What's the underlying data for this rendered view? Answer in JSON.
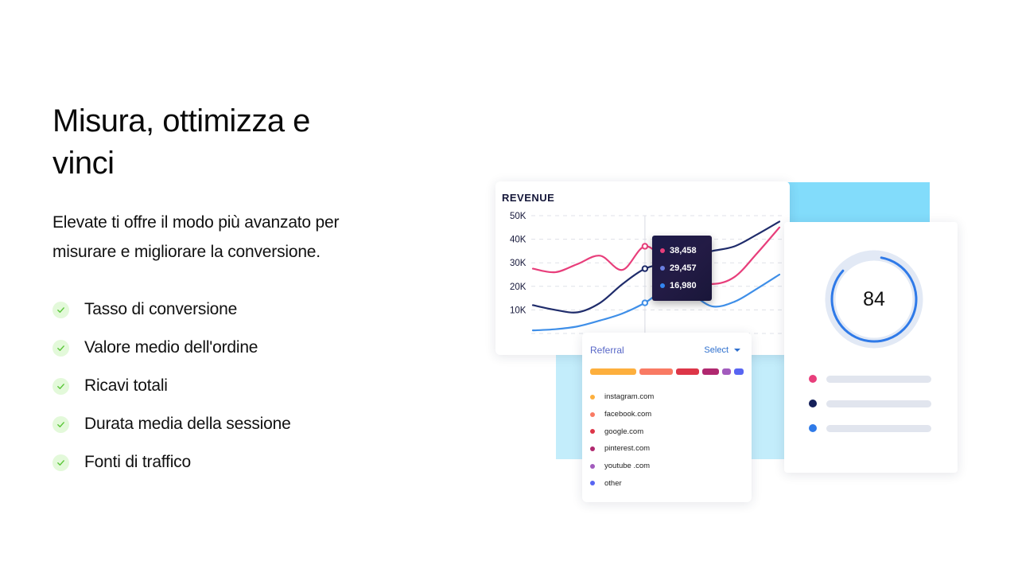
{
  "hero": {
    "headline": "Misura, ottimizza e vinci",
    "lead": "Elevate ti offre il modo più avanzato per misurare e migliorare la conversione.",
    "features": [
      {
        "label": "Tasso di conversione",
        "icon": "check-icon"
      },
      {
        "label": "Valore medio dell'ordine",
        "icon": "check-icon"
      },
      {
        "label": "Ricavi totali",
        "icon": "check-icon"
      },
      {
        "label": "Durata media della sessione",
        "icon": "check-icon"
      },
      {
        "label": "Fonti di traffico",
        "icon": "check-icon"
      }
    ]
  },
  "colors": {
    "check_bg": "#e3f9da",
    "check_fg": "#5cc73b",
    "accent_blue_bg": "#82dcfb",
    "series_pink": "#e83e7b",
    "series_navy": "#1f2c6b",
    "series_blue": "#3f8fe8"
  },
  "revenue": {
    "title": "REVENUE",
    "tooltip": [
      {
        "value": "38,458",
        "color": "#e83e7b"
      },
      {
        "value": "29,457",
        "color": "#6a7fe0"
      },
      {
        "value": "16,980",
        "color": "#3385f0"
      }
    ]
  },
  "chart_data": {
    "type": "line",
    "title": "REVENUE",
    "xlabel": "",
    "ylabel": "",
    "ylim": [
      0,
      50000
    ],
    "yticks": [
      "50K",
      "40K",
      "30K",
      "20K",
      "10K"
    ],
    "ytick_values": [
      50000,
      40000,
      30000,
      20000,
      10000
    ],
    "grid": true,
    "hover_index": 5,
    "x": [
      0,
      1,
      2,
      3,
      4,
      5,
      6,
      7,
      8,
      9,
      10,
      11
    ],
    "series": [
      {
        "name": "pink",
        "color": "#e83e7b",
        "values": [
          27500,
          26000,
          29500,
          33000,
          27000,
          37000,
          30000,
          24000,
          21000,
          24000,
          34000,
          45000
        ]
      },
      {
        "name": "navy",
        "color": "#1f2c6b",
        "values": [
          12000,
          10000,
          9000,
          13000,
          21000,
          27500,
          30000,
          33000,
          35000,
          37000,
          42000,
          47500
        ]
      },
      {
        "name": "blue",
        "color": "#3f8fe8",
        "values": [
          1300,
          1800,
          3000,
          5500,
          8500,
          13000,
          19000,
          17000,
          11500,
          13500,
          19000,
          25000
        ]
      }
    ]
  },
  "referral": {
    "title": "Referral",
    "select_label": "Select",
    "bar": [
      {
        "share": 0.3,
        "color": "#fdaf3d"
      },
      {
        "share": 0.22,
        "color": "#f97a63"
      },
      {
        "share": 0.15,
        "color": "#dd3648"
      },
      {
        "share": 0.11,
        "color": "#b0286f"
      },
      {
        "share": 0.06,
        "color": "#a25bbd"
      },
      {
        "share": 0.06,
        "color": "#5865f2"
      }
    ],
    "sources": [
      {
        "label": "instagram.com",
        "color": "#fdaf3d"
      },
      {
        "label": "facebook.com",
        "color": "#f97a63"
      },
      {
        "label": "google.com",
        "color": "#dd3648"
      },
      {
        "label": "pinterest.com",
        "color": "#b0286f"
      },
      {
        "label": "youtube .com",
        "color": "#a25bbd"
      },
      {
        "label": "other",
        "color": "#5865f2"
      }
    ]
  },
  "score": {
    "value": "84",
    "progress": 0.84,
    "ring_color": "#2f7ae8",
    "track_color": "#e2e9f5",
    "legend": [
      {
        "color": "#e83e7b"
      },
      {
        "color": "#15205a"
      },
      {
        "color": "#2f7ae8"
      }
    ]
  }
}
